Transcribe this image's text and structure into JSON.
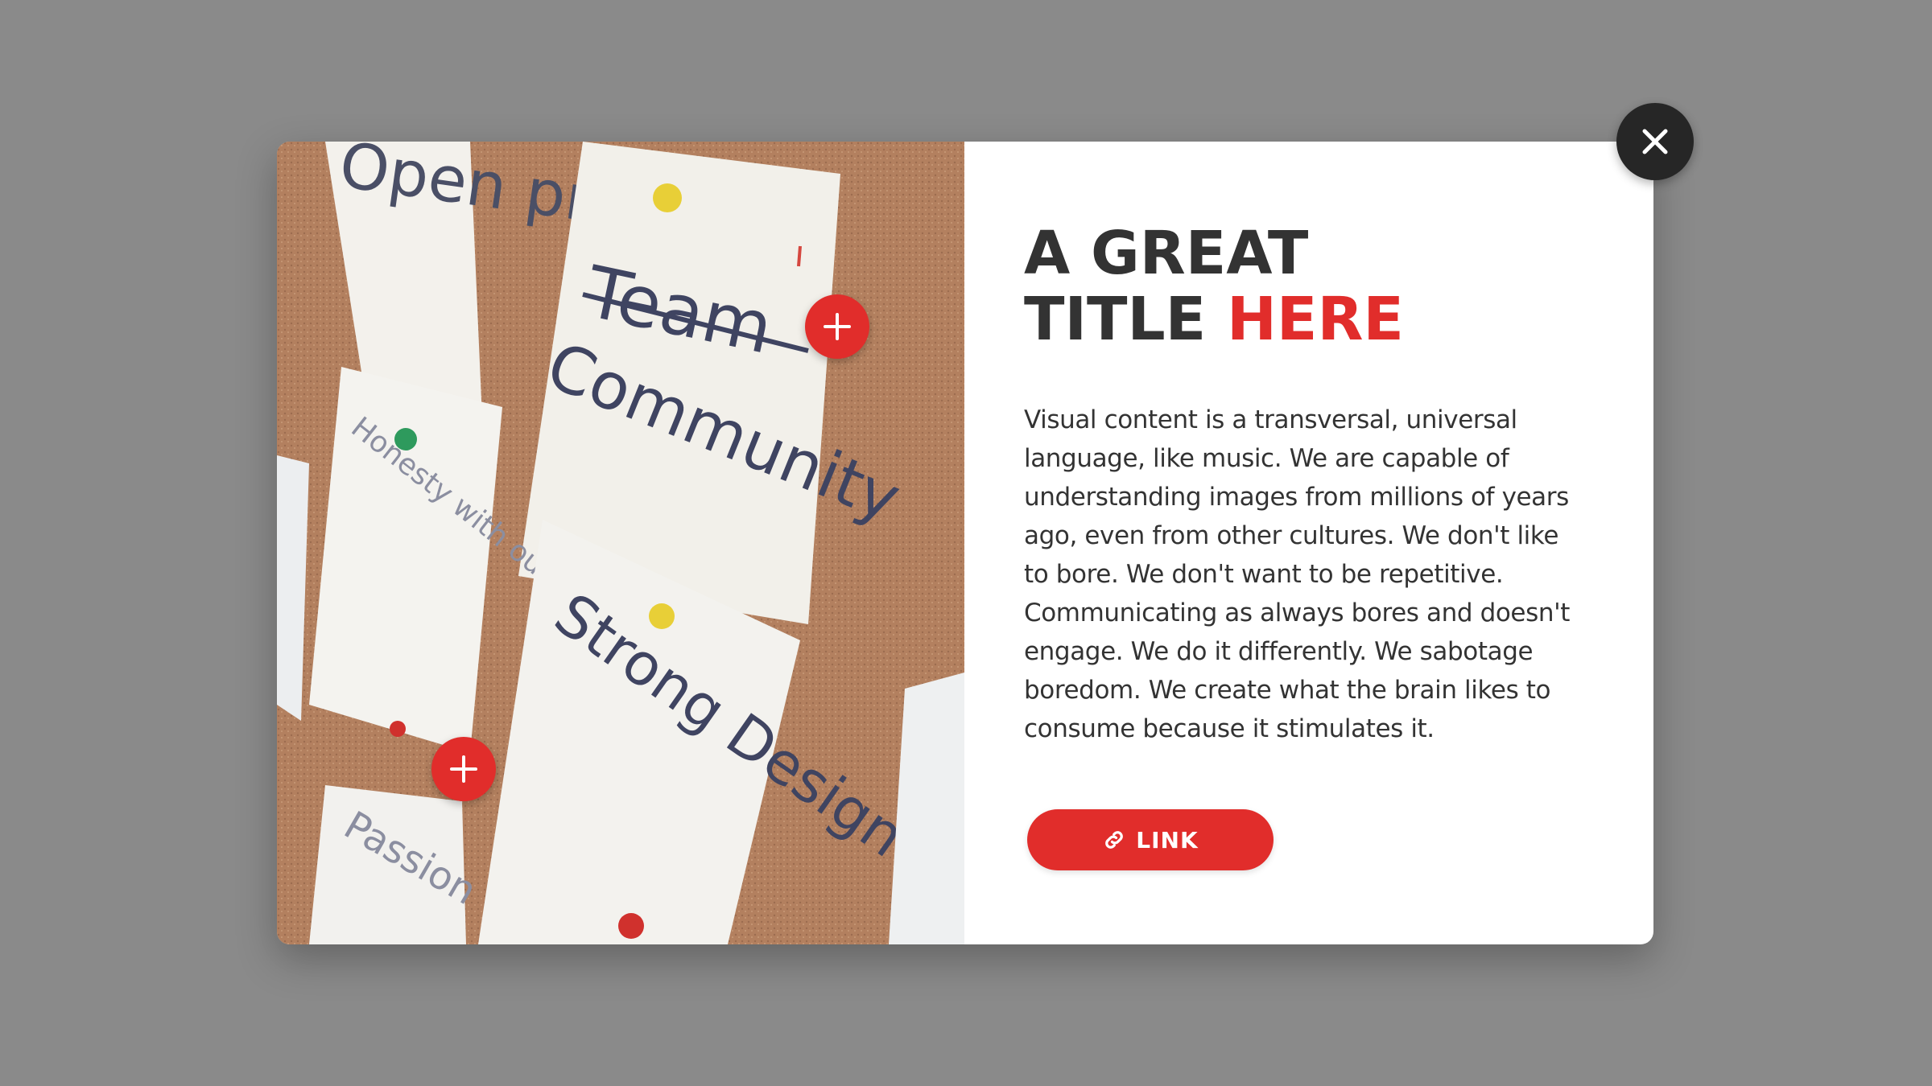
{
  "modal": {
    "title_line1": "A GREAT",
    "title_line2_prefix": "TITLE ",
    "title_line2_accent": "HERE",
    "body": "Visual content is a transversal, universal language, like music. We are capable of understanding images from millions of years ago, even from other cultures. We don't like to bore. We don't want to be repetitive. Communicating as always bores and doesn't engage. We do it differently. We sabotage boredom. We create what the brain likes to consume because it stimulates it.",
    "link_label": "LINK",
    "link_icon": "link-icon",
    "close_icon": "close-icon",
    "hotspot_icon": "plus-icon"
  },
  "photo": {
    "notes": [
      "Open process",
      "Team",
      "Community",
      "Honesty with ourselves",
      "Strong Design Skills",
      "Passion"
    ]
  },
  "colors": {
    "accent": "#e12d2b",
    "title": "#333333",
    "overlay": "#8a8a8a",
    "close_bg": "#262626"
  }
}
